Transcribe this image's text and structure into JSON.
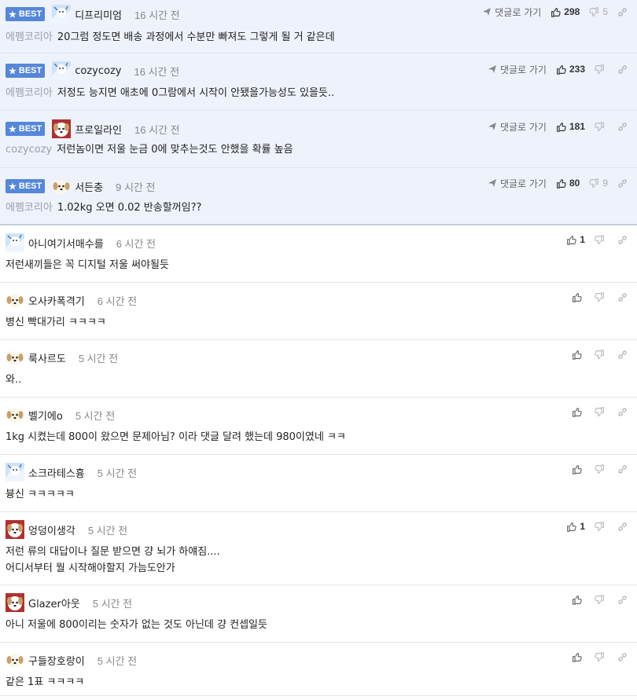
{
  "best_label": "BEST",
  "goto_label": "댓글로 가기",
  "best_comments": [
    {
      "nick": "디프리미엄",
      "avatar": "avatar-snow-icon",
      "time": "16 시간 전",
      "reply_to": "에펨코리아",
      "text": "20그럼 정도면 배송 과정에서 수분만 빠져도 그렇게 될 거 같은데",
      "likes": "298",
      "dislikes": "5"
    },
    {
      "nick": "cozycozy",
      "avatar": "avatar-snow-icon",
      "time": "16 시간 전",
      "reply_to": "에펨코리아",
      "text": "저정도 능지면 애초에 0그람에서 시작이 안됐을가능성도 있을듯..",
      "likes": "233",
      "dislikes": ""
    },
    {
      "nick": "프로일라인",
      "avatar": "avatar-dog-red-icon",
      "time": "16 시간 전",
      "reply_to": "cozycozy",
      "text": "저런놈이면 저울 눈금 0에 맞추는것도 안했을 확률 높음",
      "likes": "181",
      "dislikes": ""
    },
    {
      "nick": "서든충",
      "avatar": "avatar-dog-icon",
      "time": "9 시간 전",
      "reply_to": "에펨코리아",
      "text": "1.02kg 오면 0.02 반송할꺼임??",
      "likes": "80",
      "dislikes": "9"
    }
  ],
  "comments": [
    {
      "nick": "아니여기서매수를",
      "avatar": "avatar-snow-icon",
      "time": "6 시간 전",
      "lines": [
        "저런새끼들은 꼭 디지털 저울 써야될듯"
      ],
      "likes": "1",
      "dislikes": ""
    },
    {
      "nick": "오사카폭격기",
      "avatar": "avatar-dog-icon",
      "time": "6 시간 전",
      "lines": [
        "병신 빡대가리 ㅋㅋㅋㅋ"
      ],
      "likes": "",
      "dislikes": ""
    },
    {
      "nick": "룩사르도",
      "avatar": "avatar-dog-icon",
      "time": "5 시간 전",
      "lines": [
        "와.."
      ],
      "likes": "",
      "dislikes": ""
    },
    {
      "nick": "벨기에o",
      "avatar": "avatar-dog-icon",
      "time": "5 시간 전",
      "lines": [
        "1kg 시켰는데 800이 왔으면 문제아님? 이라 댓글 달려 했는데 980이였네 ㅋㅋ"
      ],
      "likes": "",
      "dislikes": ""
    },
    {
      "nick": "소크라테스흉",
      "avatar": "avatar-snow-icon",
      "time": "5 시간 전",
      "lines": [
        "븅신 ㅋㅋㅋㅋㅋ"
      ],
      "likes": "",
      "dislikes": ""
    },
    {
      "nick": "엉덩이생각",
      "avatar": "avatar-dog-red-icon",
      "time": "5 시간 전",
      "lines": [
        "저런 류의 대답이나 질문 받으면 걍 뇌가 하얘짐....",
        "어디서부터 뭘 시작해야할지 가늠도안가"
      ],
      "likes": "1",
      "dislikes": ""
    },
    {
      "nick": "Glazer아웃",
      "avatar": "avatar-dog-red-icon",
      "time": "5 시간 전",
      "lines": [
        "아니 저울에 800이리는 숫자가 없는 것도 아닌데 걍 컨셉일듯"
      ],
      "likes": "",
      "dislikes": ""
    },
    {
      "nick": "구들장호랑이",
      "avatar": "avatar-dog-icon",
      "time": "5 시간 전",
      "lines": [
        "같은 1표 ㅋㅋㅋㅋ"
      ],
      "likes": "",
      "dislikes": ""
    }
  ]
}
